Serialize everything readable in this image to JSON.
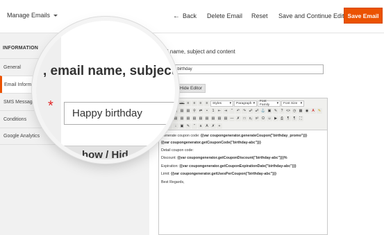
{
  "header": {
    "manage_emails": "Manage Emails",
    "back": "Back",
    "delete": "Delete Email",
    "reset": "Reset",
    "save_continue": "Save and Continue Edit",
    "save": "Save Email",
    "accent_color": "#eb5202"
  },
  "sidebar": {
    "heading": "INFORMATION",
    "items": [
      {
        "label": "General"
      },
      {
        "label": "Email Informati"
      },
      {
        "label": "SMS Message"
      },
      {
        "label": "Conditions"
      },
      {
        "label": "Google Analytics"
      }
    ]
  },
  "main": {
    "section_title": "mail name, subject and content",
    "subject_value": "ppy birthday",
    "show_hide": "/ Hide Editor"
  },
  "toolbar": {
    "styles": "Styles",
    "paragraph": "Paragraph",
    "font_family": "Font Family",
    "font_size": "Font Size",
    "bold": "B",
    "italic": "I",
    "underline": "U",
    "strike": "ABC"
  },
  "editor": {
    "line1_text": "Generate coupon code: ",
    "line1_code": "{{var coupongenerator.generateCoupon(\"birthday_promo\")}}",
    "line2_code": "{{var coupongenerator.getCouponCode(\"birthday-abc\")}}",
    "line3_text": "Detail coupon code:",
    "line4_text": "Discount: ",
    "line4_code": "{{var coupongenerator.getCouponDiscount(\"birthday-abc\")}}%",
    "line5_text": "Expiration: ",
    "line5_code": "{{var coupongenerator.getCouponExpirationDate(\"birthday-abc\")}}",
    "line6_text": "Limit: ",
    "line6_code": "{{var coupongenerator.getUsesPerCoupon(\"birthday-abc\")}}",
    "line7_text": "Best Regards,"
  },
  "magnifier": {
    "title": ", email name, subject a",
    "required_star": "*",
    "input_value": "Happy birthday",
    "button_text": "how / Hid"
  }
}
